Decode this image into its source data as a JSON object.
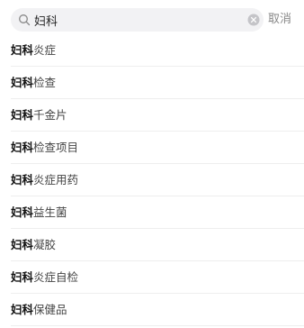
{
  "search": {
    "value": "妇科",
    "cancel_label": "取消"
  },
  "suggestions": [
    {
      "highlight": "妇科",
      "rest": "炎症"
    },
    {
      "highlight": "妇科",
      "rest": "检查"
    },
    {
      "highlight": "妇科",
      "rest": "千金片"
    },
    {
      "highlight": "妇科",
      "rest": "检查项目"
    },
    {
      "highlight": "妇科",
      "rest": "炎症用药"
    },
    {
      "highlight": "妇科",
      "rest": "益生菌"
    },
    {
      "highlight": "妇科",
      "rest": "凝胶"
    },
    {
      "highlight": "妇科",
      "rest": "炎症自检"
    },
    {
      "highlight": "妇科",
      "rest": "保健品"
    }
  ],
  "icons": {
    "search": "search-icon",
    "clear": "clear-icon"
  },
  "colors": {
    "search_bg": "#f2f2f4",
    "cancel_text": "#888888",
    "divider": "#eeeeee"
  }
}
